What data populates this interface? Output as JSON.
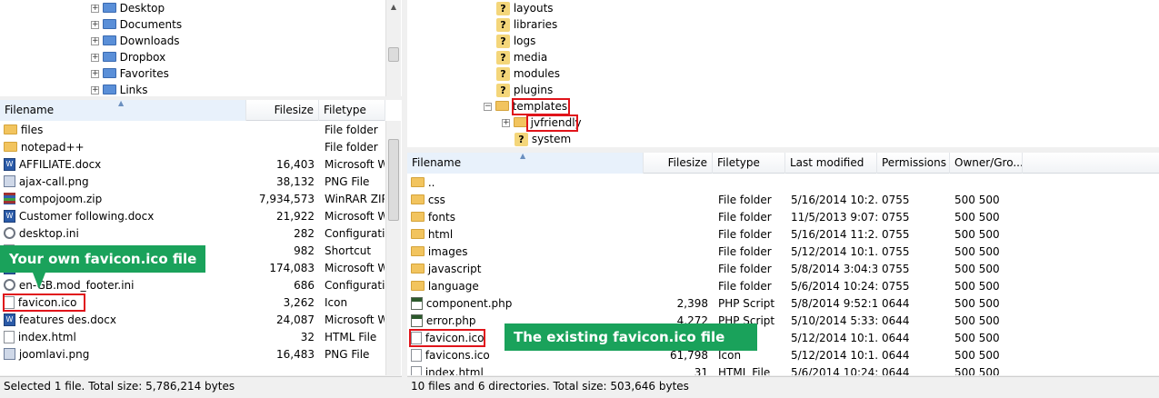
{
  "left_tree": {
    "items": [
      "Desktop",
      "Documents",
      "Downloads",
      "Dropbox",
      "Favorites",
      "Links"
    ]
  },
  "left_list": {
    "columns": [
      "Filename",
      "Filesize",
      "Filetype"
    ],
    "rows": [
      {
        "name": "files",
        "size": "",
        "type": "File folder",
        "icon": "folder"
      },
      {
        "name": "notepad++",
        "size": "",
        "type": "File folder",
        "icon": "folder"
      },
      {
        "name": "AFFILIATE.docx",
        "size": "16,403",
        "type": "Microsoft Wo",
        "icon": "word"
      },
      {
        "name": "ajax-call.png",
        "size": "38,132",
        "type": "PNG File",
        "icon": "image"
      },
      {
        "name": "compojoom.zip",
        "size": "7,934,573",
        "type": "WinRAR ZIP",
        "icon": "zip"
      },
      {
        "name": "Customer following.docx",
        "size": "21,922",
        "type": "Microsoft Wo",
        "icon": "word"
      },
      {
        "name": "desktop.ini",
        "size": "282",
        "type": "Configuratio",
        "icon": "gear"
      },
      {
        "name": "",
        "size": "982",
        "type": "Shortcut",
        "icon": "doc"
      },
      {
        "name": "",
        "size": "174,083",
        "type": "Microsoft Wo",
        "icon": "word"
      },
      {
        "name": "en-GB.mod_footer.ini",
        "size": "686",
        "type": "Configuratio",
        "icon": "gear"
      },
      {
        "name": "favicon.ico",
        "size": "3,262",
        "type": "Icon",
        "icon": "doc"
      },
      {
        "name": "features des.docx",
        "size": "24,087",
        "type": "Microsoft Wo",
        "icon": "word"
      },
      {
        "name": "index.html",
        "size": "32",
        "type": "HTML File",
        "icon": "doc"
      },
      {
        "name": "joomlavi.png",
        "size": "16,483",
        "type": "PNG File",
        "icon": "image"
      }
    ]
  },
  "left_status": "Selected 1 file. Total size: 5,786,214 bytes",
  "right_tree": {
    "items": [
      "layouts",
      "libraries",
      "logs",
      "media",
      "modules",
      "plugins",
      "templates",
      "jvfriendly",
      "system"
    ]
  },
  "right_list": {
    "columns": [
      "Filename",
      "Filesize",
      "Filetype",
      "Last modified",
      "Permissions",
      "Owner/Gro..."
    ],
    "rows": [
      {
        "name": "..",
        "size": "",
        "type": "",
        "modified": "",
        "perm": "",
        "owner": "",
        "icon": "folder"
      },
      {
        "name": "css",
        "size": "",
        "type": "File folder",
        "modified": "5/16/2014 10:2...",
        "perm": "0755",
        "owner": "500 500",
        "icon": "folder"
      },
      {
        "name": "fonts",
        "size": "",
        "type": "File folder",
        "modified": "11/5/2013 9:07:...",
        "perm": "0755",
        "owner": "500 500",
        "icon": "folder"
      },
      {
        "name": "html",
        "size": "",
        "type": "File folder",
        "modified": "5/16/2014 11:2...",
        "perm": "0755",
        "owner": "500 500",
        "icon": "folder"
      },
      {
        "name": "images",
        "size": "",
        "type": "File folder",
        "modified": "5/12/2014 10:1...",
        "perm": "0755",
        "owner": "500 500",
        "icon": "folder"
      },
      {
        "name": "javascript",
        "size": "",
        "type": "File folder",
        "modified": "5/8/2014 3:04:3...",
        "perm": "0755",
        "owner": "500 500",
        "icon": "folder"
      },
      {
        "name": "language",
        "size": "",
        "type": "File folder",
        "modified": "5/6/2014 10:24:...",
        "perm": "0755",
        "owner": "500 500",
        "icon": "folder"
      },
      {
        "name": "component.php",
        "size": "2,398",
        "type": "PHP Script",
        "modified": "5/8/2014 9:52:1...",
        "perm": "0644",
        "owner": "500 500",
        "icon": "php"
      },
      {
        "name": "error.php",
        "size": "4,272",
        "type": "PHP Script",
        "modified": "5/10/2014 5:33:...",
        "perm": "0644",
        "owner": "500 500",
        "icon": "php"
      },
      {
        "name": "favicon.ico",
        "size": "",
        "type": "",
        "modified": "5/12/2014 10:1...",
        "perm": "0644",
        "owner": "500 500",
        "icon": "doc"
      },
      {
        "name": "favicons.ico",
        "size": "61,798",
        "type": "Icon",
        "modified": "5/12/2014 10:1...",
        "perm": "0644",
        "owner": "500 500",
        "icon": "doc"
      },
      {
        "name": "index.html",
        "size": "31",
        "type": "HTML File",
        "modified": "5/6/2014 10:24:...",
        "perm": "0644",
        "owner": "500 500",
        "icon": "doc"
      }
    ]
  },
  "right_status": "10 files and 6 directories. Total size: 503,646 bytes",
  "callouts": {
    "left": "Your own favicon.ico file",
    "right": "The existing favicon.ico file"
  },
  "colors": {
    "callout_bg": "#1aa25b",
    "highlight": "#e0141a",
    "folder": "#f2c45e"
  }
}
